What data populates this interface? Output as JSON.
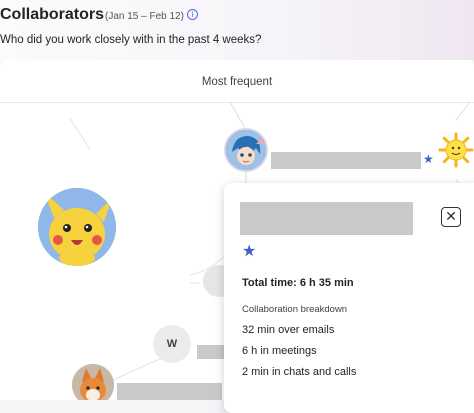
{
  "header": {
    "title": "Collaborators",
    "date_range": "(Jan 15 – Feb 12)",
    "info_icon": "info-icon",
    "subtitle": "Who did you work closely with in the past 4 weeks?"
  },
  "card": {
    "tab_label": "Most frequent"
  },
  "graph": {
    "nodes": [
      {
        "name": "collaborator-anime-avatar",
        "icon": "anime-character-avatar"
      },
      {
        "name": "collaborator-pikachu-avatar",
        "icon": "pikachu-avatar"
      },
      {
        "name": "collaborator-sun-avatar",
        "icon": "sun-avatar"
      },
      {
        "name": "collaborator-initial-w",
        "initial": "W"
      },
      {
        "name": "collaborator-fox-avatar",
        "icon": "fox-avatar"
      }
    ],
    "star_icon": "star-icon"
  },
  "popup": {
    "close_icon": "close-icon",
    "star_icon": "star-icon",
    "total_time": "Total time: 6 h 35 min",
    "breakdown_label": "Collaboration breakdown",
    "breakdown": [
      "32 min over emails",
      "6 h in meetings",
      "2 min in chats and calls"
    ]
  },
  "colors": {
    "accent": "#3c5fd1",
    "redacted": "#c9c9c9"
  }
}
